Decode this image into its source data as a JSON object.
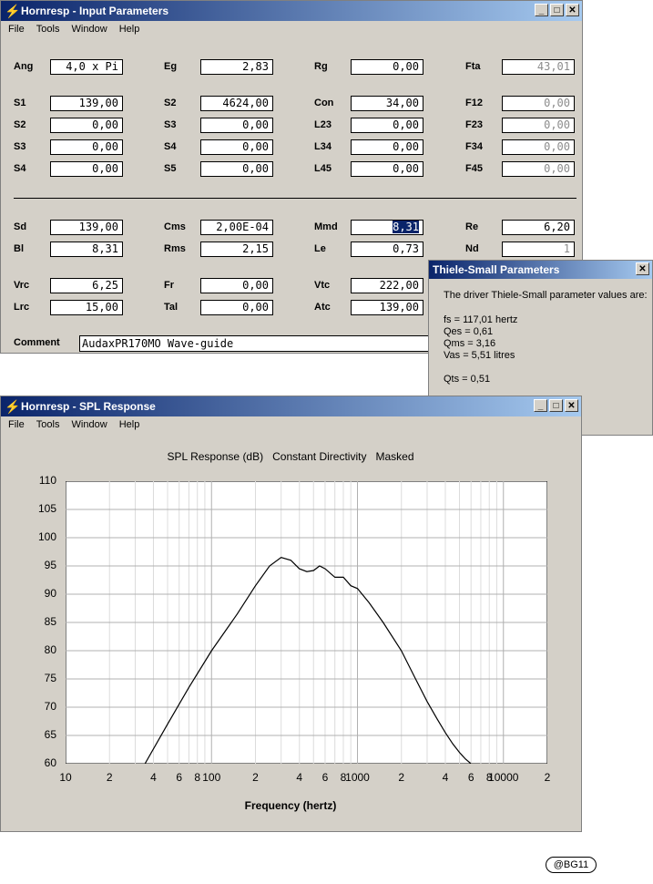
{
  "input_window": {
    "title": "Hornresp - Input Parameters",
    "menu": [
      "File",
      "Tools",
      "Window",
      "Help"
    ],
    "fields": [
      {
        "label": "Ang",
        "value": "4,0 x Pi",
        "kind": "normal"
      },
      {
        "label": "Eg",
        "value": "2,83",
        "kind": "normal"
      },
      {
        "label": "Rg",
        "value": "0,00",
        "kind": "normal"
      },
      {
        "label": "Fta",
        "value": "43,01",
        "kind": "gray"
      },
      {
        "label": "S1",
        "value": "139,00",
        "kind": "normal"
      },
      {
        "label": "S2",
        "value": "4624,00",
        "kind": "normal"
      },
      {
        "label": "Con",
        "value": "34,00",
        "kind": "normal"
      },
      {
        "label": "F12",
        "value": "0,00",
        "kind": "gray"
      },
      {
        "label": "S2",
        "value": "0,00",
        "kind": "normal"
      },
      {
        "label": "S3",
        "value": "0,00",
        "kind": "normal"
      },
      {
        "label": "L23",
        "value": "0,00",
        "kind": "normal"
      },
      {
        "label": "F23",
        "value": "0,00",
        "kind": "gray"
      },
      {
        "label": "S3",
        "value": "0,00",
        "kind": "normal"
      },
      {
        "label": "S4",
        "value": "0,00",
        "kind": "normal"
      },
      {
        "label": "L34",
        "value": "0,00",
        "kind": "normal"
      },
      {
        "label": "F34",
        "value": "0,00",
        "kind": "gray"
      },
      {
        "label": "S4",
        "value": "0,00",
        "kind": "normal"
      },
      {
        "label": "S5",
        "value": "0,00",
        "kind": "normal"
      },
      {
        "label": "L45",
        "value": "0,00",
        "kind": "normal"
      },
      {
        "label": "F45",
        "value": "0,00",
        "kind": "gray"
      },
      {
        "label": "Sd",
        "value": "139,00",
        "kind": "normal"
      },
      {
        "label": "Cms",
        "value": "2,00E-04",
        "kind": "normal"
      },
      {
        "label": "Mmd",
        "value": "8,31",
        "kind": "selected"
      },
      {
        "label": "Re",
        "value": "6,20",
        "kind": "normal"
      },
      {
        "label": "Bl",
        "value": "8,31",
        "kind": "normal"
      },
      {
        "label": "Rms",
        "value": "2,15",
        "kind": "normal"
      },
      {
        "label": "Le",
        "value": "0,73",
        "kind": "normal"
      },
      {
        "label": "Nd",
        "value": "1",
        "kind": "gray"
      },
      {
        "label": "Vrc",
        "value": "6,25",
        "kind": "normal"
      },
      {
        "label": "Fr",
        "value": "0,00",
        "kind": "normal"
      },
      {
        "label": "Vtc",
        "value": "222,00",
        "kind": "normal"
      },
      {
        "label": "Lrc",
        "value": "15,00",
        "kind": "normal"
      },
      {
        "label": "Tal",
        "value": "0,00",
        "kind": "normal"
      },
      {
        "label": "Atc",
        "value": "139,00",
        "kind": "normal"
      }
    ],
    "comment_label": "Comment",
    "comment_value": "AudaxPR170MO Wave-guide"
  },
  "ts_window": {
    "title": "Thiele-Small Parameters",
    "intro": "The driver Thiele-Small parameter values are:",
    "lines": [
      "fs = 117,01 hertz",
      "Qes = 0,61",
      "Qms = 3,16",
      "Vas = 5,51 litres"
    ],
    "qts": "Qts = 0,51"
  },
  "spl_window": {
    "title": "Hornresp - SPL Response",
    "menu": [
      "File",
      "Tools",
      "Window",
      "Help"
    ],
    "chart_title": "SPL Response (dB)   Constant Directivity   Masked",
    "xlabel": "Frequency (hertz)",
    "ytick_labels": [
      "110",
      "105",
      "100",
      "95",
      "90",
      "85",
      "80",
      "75",
      "70",
      "65",
      "60"
    ],
    "xtick_labels": [
      "10",
      "2",
      "4",
      "6",
      "8",
      "100",
      "2",
      "4",
      "6",
      "8",
      "1000",
      "2",
      "4",
      "6",
      "8",
      "10000",
      "2"
    ]
  },
  "watermark": "@BG11",
  "chart_data": {
    "type": "line",
    "title": "SPL Response (dB)   Constant Directivity   Masked",
    "xlabel": "Frequency (hertz)",
    "ylabel": "",
    "x_scale": "log",
    "xlim": [
      10,
      20000
    ],
    "ylim": [
      60,
      110
    ],
    "grid": true,
    "series": [
      {
        "x": [
          35,
          50,
          70,
          100,
          150,
          200,
          250,
          300,
          350,
          400,
          450,
          500,
          550,
          600,
          700,
          800,
          900,
          1000,
          1200,
          1500,
          2000,
          2500,
          3000,
          3500,
          4000,
          4500,
          5000,
          5500,
          6000
        ],
        "y": [
          60,
          67,
          73.5,
          80,
          86.5,
          91.5,
          95,
          96.5,
          96,
          94.5,
          94,
          94.2,
          95,
          94.5,
          93,
          93,
          91.5,
          91,
          88.5,
          85,
          80,
          75,
          71,
          68,
          65.5,
          63.5,
          62,
          60.8,
          60
        ]
      }
    ]
  }
}
